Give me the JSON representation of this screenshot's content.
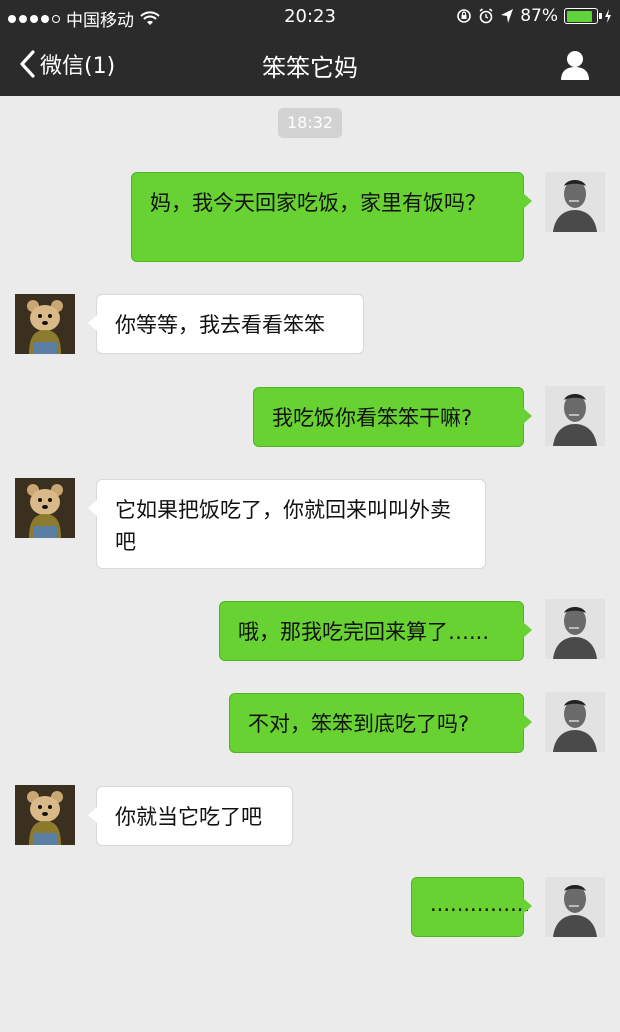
{
  "status_bar": {
    "carrier": "中国移动",
    "time": "20:23",
    "battery_percent": "87%",
    "battery_level": 0.87
  },
  "nav": {
    "back_label": "微信(1)",
    "title": "笨笨它妈"
  },
  "chat": {
    "timestamp": "18:32",
    "messages": [
      {
        "from": "self",
        "text": "妈，我今天回家吃饭，家里有饭吗？"
      },
      {
        "from": "other",
        "text": "你等等，我去看看笨笨"
      },
      {
        "from": "self",
        "text": "我吃饭你看笨笨干嘛?"
      },
      {
        "from": "other",
        "text": "它如果把饭吃了，你就回来叫叫外卖吧"
      },
      {
        "from": "self",
        "text": "哦，那我吃完回来算了…..."
      },
      {
        "from": "self",
        "text": "不对，笨笨到底吃了吗?"
      },
      {
        "from": "other",
        "text": "你就当它吃了吧"
      },
      {
        "from": "self",
        "text": "..............."
      }
    ]
  },
  "colors": {
    "bar_bg": "#2b2b2b",
    "chat_bg": "#ebebeb",
    "outgoing_bubble": "#67d232",
    "incoming_bubble": "#ffffff"
  }
}
